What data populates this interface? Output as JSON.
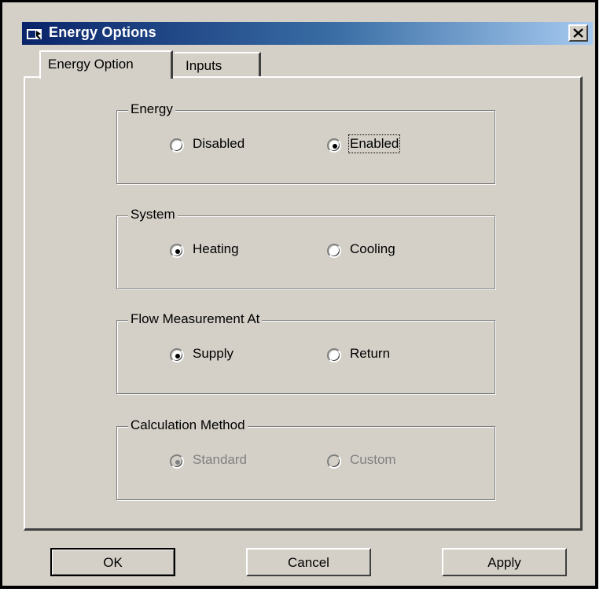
{
  "window": {
    "title": "Energy Options",
    "close_icon": "close-icon",
    "app_icon": "window-icon"
  },
  "tabs": [
    {
      "label": "Energy Option",
      "selected": true
    },
    {
      "label": "Inputs",
      "selected": false
    }
  ],
  "groups": {
    "energy": {
      "label": "Energy",
      "options": [
        {
          "label": "Disabled",
          "checked": false
        },
        {
          "label": "Enabled",
          "checked": true
        }
      ]
    },
    "system": {
      "label": "System",
      "options": [
        {
          "label": "Heating",
          "checked": true
        },
        {
          "label": "Cooling",
          "checked": false
        }
      ]
    },
    "flow": {
      "label": "Flow Measurement At",
      "options": [
        {
          "label": "Supply",
          "checked": true
        },
        {
          "label": "Return",
          "checked": false
        }
      ]
    },
    "calc": {
      "label": "Calculation Method",
      "disabled": true,
      "options": [
        {
          "label": "Standard",
          "checked": true
        },
        {
          "label": "Custom",
          "checked": false
        }
      ]
    }
  },
  "buttons": {
    "ok": "OK",
    "cancel": "Cancel",
    "apply": "Apply"
  },
  "colors": {
    "face": "#d4d0c8",
    "title_start": "#0a246a",
    "title_end": "#a6caf0",
    "disabled_text": "#808080"
  }
}
